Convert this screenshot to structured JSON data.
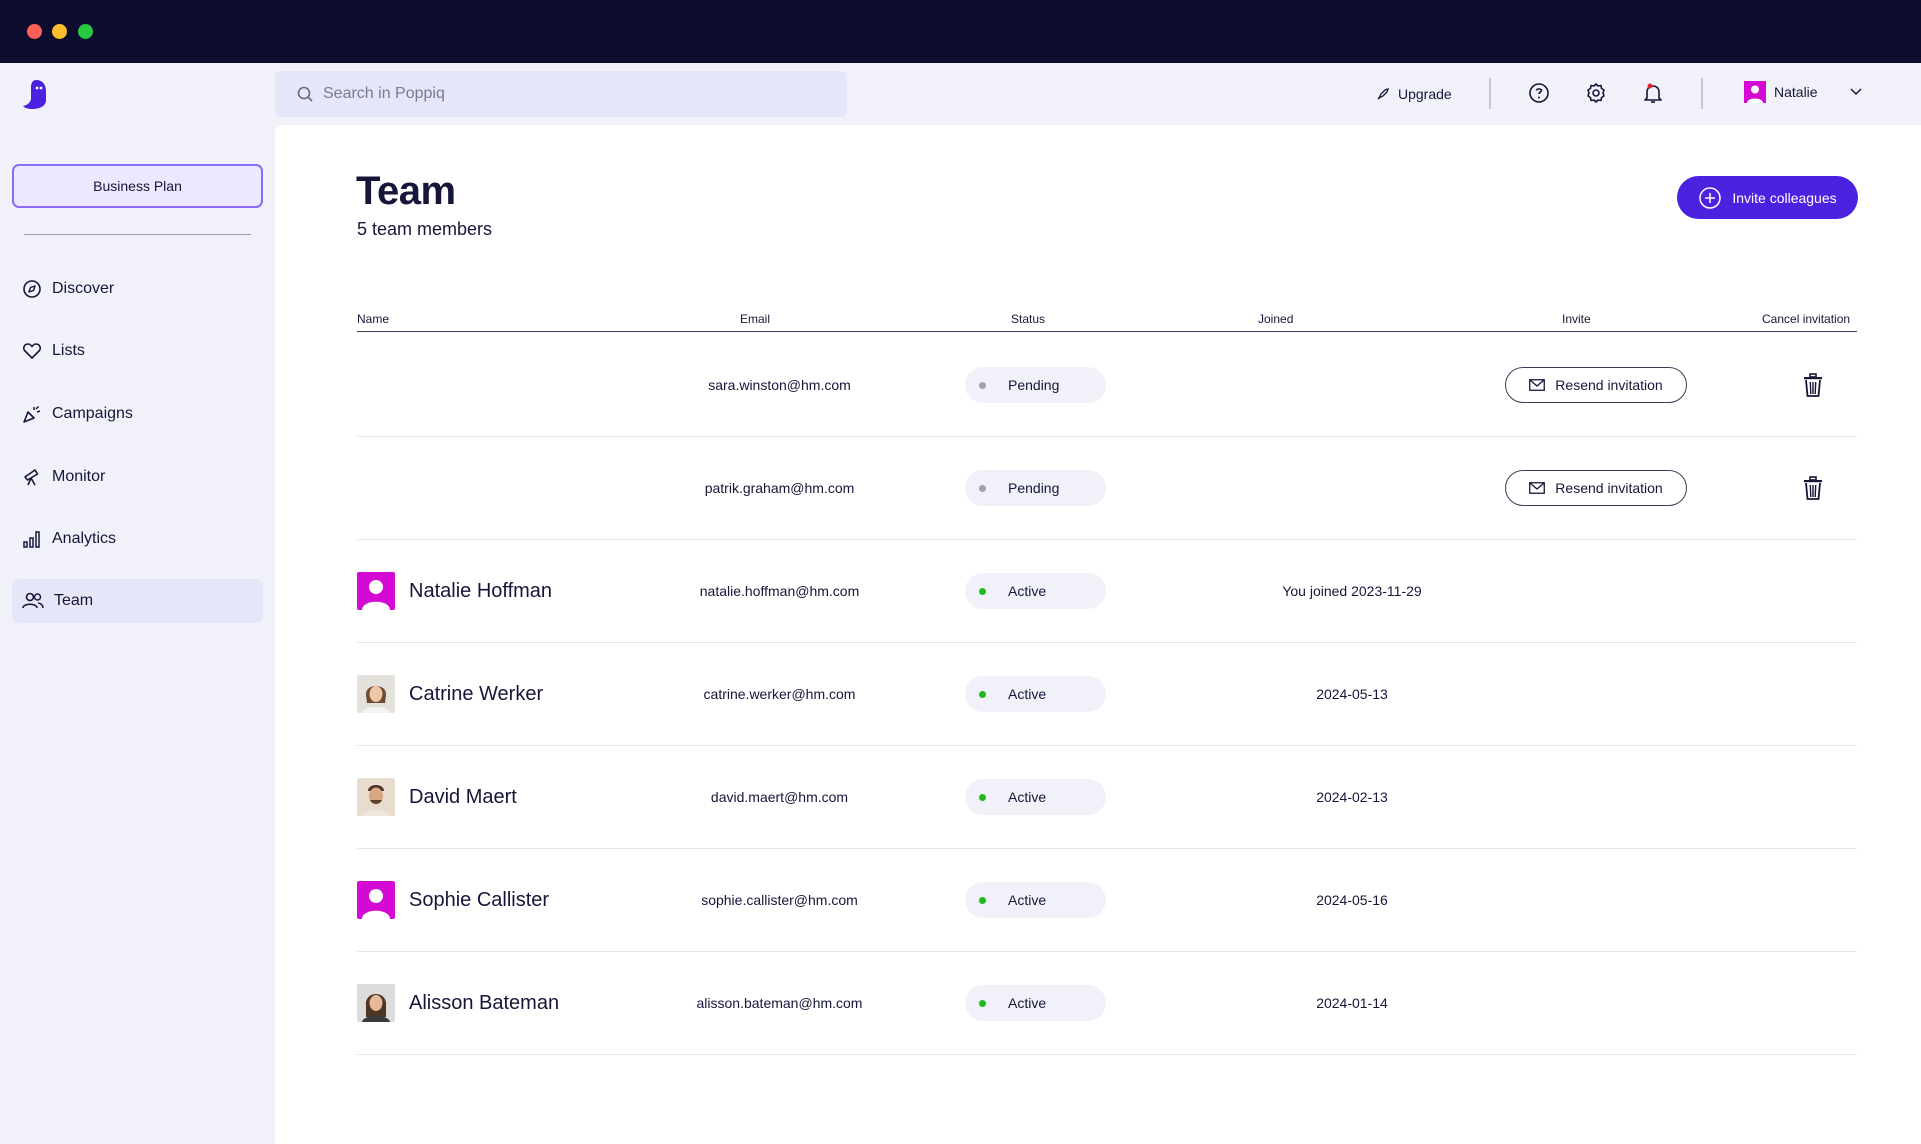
{
  "window": {
    "controls": [
      "close",
      "minimize",
      "maximize"
    ]
  },
  "topbar": {
    "search_placeholder": "Search in Poppiq",
    "upgrade_label": "Upgrade",
    "icons": [
      "help-icon",
      "settings-icon",
      "notification-bell-icon"
    ],
    "user_name": "Natalie"
  },
  "sidebar": {
    "plan_label": "Business Plan",
    "items": [
      {
        "label": "Discover",
        "icon": "compass-icon"
      },
      {
        "label": "Lists",
        "icon": "heart-icon"
      },
      {
        "label": "Campaigns",
        "icon": "party-popper-icon"
      },
      {
        "label": "Monitor",
        "icon": "telescope-icon"
      },
      {
        "label": "Analytics",
        "icon": "bar-chart-icon"
      },
      {
        "label": "Team",
        "icon": "users-icon",
        "active": true
      }
    ]
  },
  "page": {
    "title": "Team",
    "subtitle": "5 team members",
    "invite_button": "Invite colleagues"
  },
  "table": {
    "columns": [
      "Name",
      "Email",
      "Status",
      "Joined",
      "Invite",
      "Cancel invitation"
    ],
    "resend_label": "Resend invitation",
    "rows": [
      {
        "name": "",
        "email": "sara.winston@hm.com",
        "status": "Pending",
        "joined": "",
        "avatar": "none"
      },
      {
        "name": "",
        "email": "patrik.graham@hm.com",
        "status": "Pending",
        "joined": "",
        "avatar": "none"
      },
      {
        "name": "Natalie Hoffman",
        "email": "natalie.hoffman@hm.com",
        "status": "Active",
        "joined": "You joined 2023-11-29",
        "avatar": "placeholder"
      },
      {
        "name": "Catrine Werker",
        "email": "catrine.werker@hm.com",
        "status": "Active",
        "joined": "2024-05-13",
        "avatar": "photo"
      },
      {
        "name": "David Maert",
        "email": "david.maert@hm.com",
        "status": "Active",
        "joined": "2024-02-13",
        "avatar": "photo"
      },
      {
        "name": "Sophie Callister",
        "email": "sophie.callister@hm.com",
        "status": "Active",
        "joined": "2024-05-16",
        "avatar": "placeholder"
      },
      {
        "name": "Alisson Bateman",
        "email": "alisson.bateman@hm.com",
        "status": "Active",
        "joined": "2024-01-14",
        "avatar": "photo"
      }
    ]
  },
  "colors": {
    "titlebar": "#0e0c2e",
    "accent": "#4a22e0",
    "plan_border": "#8b6bf7",
    "avatar_placeholder": "#d40ad4",
    "status_active": "#1fb91f",
    "status_pending": "#a0a0b0"
  }
}
